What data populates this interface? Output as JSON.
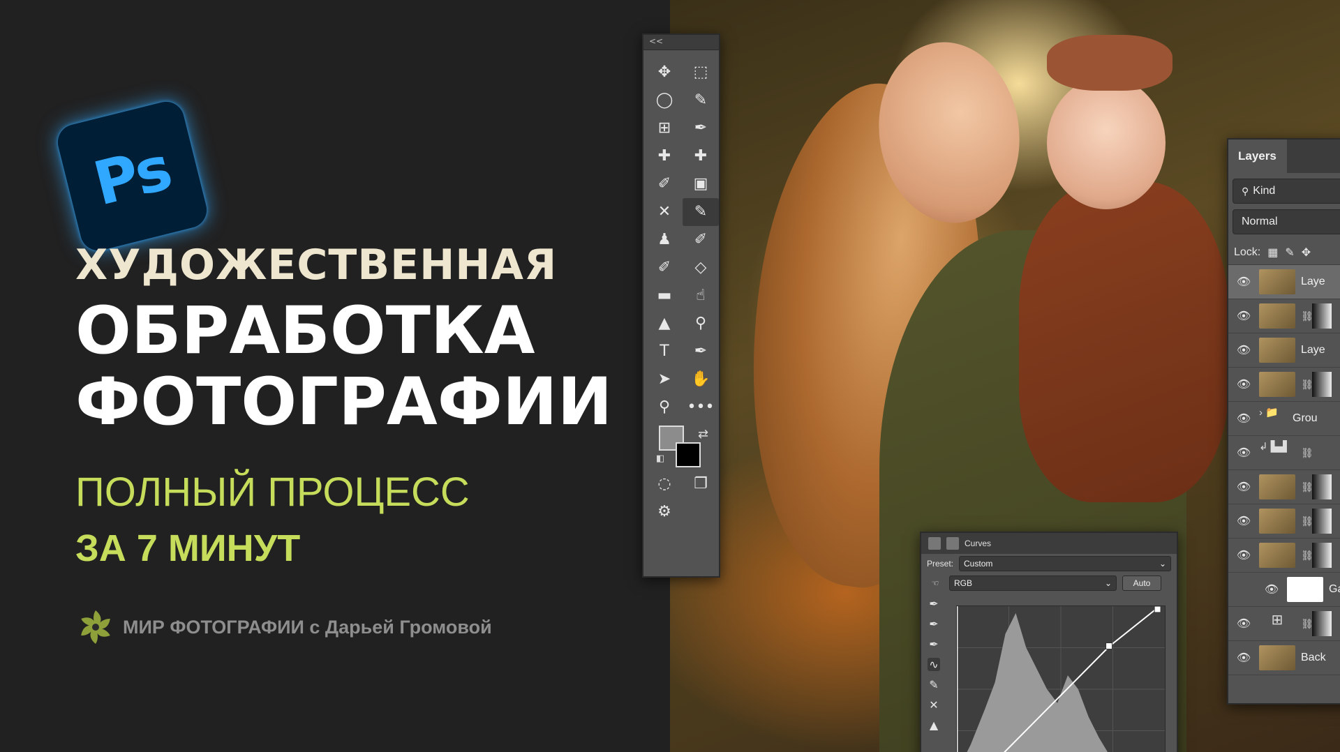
{
  "hero": {
    "logo_text": "Ps",
    "title_line1": "ХУДОЖЕСТВЕННАЯ",
    "title_line2": "ОБРАБОТКА",
    "title_line3": "ФОТОГРАФИИ",
    "subtitle_line1": "ПОЛНЫЙ ПРОЦЕСС",
    "subtitle_line2": "ЗА 7 МИНУТ",
    "brand": "МИР ФОТОГРАФИИ с Дарьей Громовой"
  },
  "colors": {
    "background": "#212121",
    "title_cream": "#efe6cf",
    "title_white": "#ffffff",
    "accent_green": "#c5dd5a",
    "ps_blue": "#31a8ff",
    "ps_dark": "#001e36",
    "panel_gray": "#535353"
  },
  "toolbar": {
    "collapse_label": "<<",
    "tools": [
      {
        "name": "move-tool",
        "glyph": "✥"
      },
      {
        "name": "marquee-tool",
        "glyph": "⬚"
      },
      {
        "name": "lasso-tool",
        "glyph": "◯"
      },
      {
        "name": "object-select-tool",
        "glyph": "✎"
      },
      {
        "name": "crop-tool",
        "glyph": "⊞"
      },
      {
        "name": "eyedropper-tool",
        "glyph": "✒"
      },
      {
        "name": "spot-healing-tool",
        "glyph": "✚"
      },
      {
        "name": "healing-brush-tool",
        "glyph": "✚"
      },
      {
        "name": "patch-tool",
        "glyph": "✐"
      },
      {
        "name": "content-aware-tool",
        "glyph": "▣"
      },
      {
        "name": "red-eye-tool",
        "glyph": "✕"
      },
      {
        "name": "brush-tool",
        "glyph": "✎"
      },
      {
        "name": "clone-stamp-tool",
        "glyph": "♟"
      },
      {
        "name": "history-brush-tool",
        "glyph": "✐"
      },
      {
        "name": "art-history-brush-tool",
        "glyph": "✐"
      },
      {
        "name": "eraser-tool",
        "glyph": "◇"
      },
      {
        "name": "gradient-tool",
        "glyph": "▬"
      },
      {
        "name": "smudge-tool",
        "glyph": "☝"
      },
      {
        "name": "sharpen-tool",
        "glyph": "▲"
      },
      {
        "name": "dodge-tool",
        "glyph": "⚲"
      },
      {
        "name": "type-tool",
        "glyph": "T"
      },
      {
        "name": "pen-tool",
        "glyph": "✒"
      },
      {
        "name": "path-select-tool",
        "glyph": "➤"
      },
      {
        "name": "hand-tool",
        "glyph": "✋"
      },
      {
        "name": "zoom-tool",
        "glyph": "⚲"
      },
      {
        "name": "more-tools",
        "glyph": "•••"
      }
    ],
    "active_tool": "brush-tool",
    "quick_mask_glyph": "◌",
    "screen_mode_glyph": "❐",
    "edit_toolbar_glyph": "⚙"
  },
  "layers_panel": {
    "tab_label": "Layers",
    "kind_filter": "Kind",
    "blend_mode": "Normal",
    "lock_label": "Lock:",
    "items": [
      {
        "label": "Laye",
        "thumb": "image",
        "selected": true,
        "link": false,
        "mask": false
      },
      {
        "label": "",
        "thumb": "image",
        "selected": false,
        "link": true,
        "mask": true
      },
      {
        "label": "Laye",
        "thumb": "image",
        "selected": false,
        "link": false,
        "mask": false
      },
      {
        "label": "",
        "thumb": "image",
        "selected": false,
        "link": true,
        "mask": true
      },
      {
        "label": "Grou",
        "thumb": "folder",
        "selected": false,
        "link": false,
        "mask": false
      },
      {
        "label": "",
        "thumb": "levels",
        "selected": false,
        "link": true,
        "mask": false
      },
      {
        "label": "",
        "thumb": "image",
        "selected": false,
        "link": true,
        "mask": true
      },
      {
        "label": "",
        "thumb": "image",
        "selected": false,
        "link": true,
        "mask": true
      },
      {
        "label": "",
        "thumb": "image",
        "selected": false,
        "link": true,
        "mask": true
      },
      {
        "label": "Ga",
        "thumb": "white",
        "selected": false,
        "link": false,
        "mask": false
      },
      {
        "label": "",
        "thumb": "curves",
        "selected": false,
        "link": true,
        "mask": true
      },
      {
        "label": "Back",
        "thumb": "image",
        "selected": false,
        "link": false,
        "mask": false
      }
    ]
  },
  "curves_panel": {
    "title": "Curves",
    "preset_label": "Preset:",
    "preset_value": "Custom",
    "channel_value": "RGB",
    "auto_label": "Auto"
  }
}
